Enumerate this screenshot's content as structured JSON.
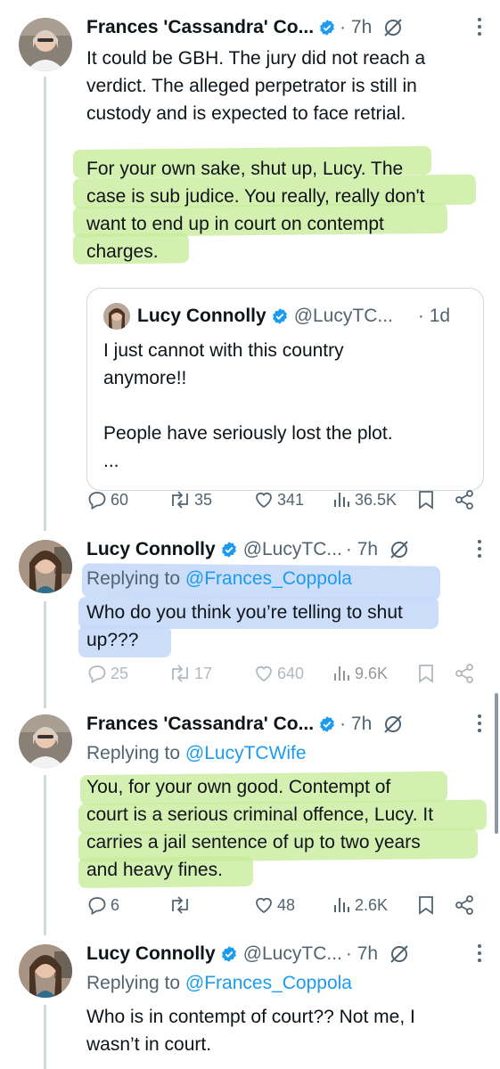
{
  "tweets": [
    {
      "author": "Frances 'Cassandra' Co...",
      "handle": "",
      "time": "· 7h",
      "text1": "It could be GBH. The jury did not reach a\nverdict. The alleged perpetrator is still in\ncustody and is expected to face retrial.",
      "text2": "For your own sake, shut up, Lucy. The\ncase is sub judice. You really, really don't\nwant to end up in court on contempt\ncharges.",
      "quote": {
        "author": "Lucy Connolly",
        "handle": "@LucyTC...",
        "time": "· 1d",
        "text": "I just cannot with this country\nanymore!!\n\nPeople have seriously lost the plot.\n..."
      },
      "replies": "60",
      "reposts": "35",
      "likes": "341",
      "views": "36.5K"
    },
    {
      "author": "Lucy Connolly",
      "handle": "@LucyTC...",
      "time": "· 7h",
      "replying_prefix": "Replying to",
      "replying_to": "@Frances_Coppola",
      "text": "Who do you think you’re telling to shut\nup???",
      "replies": "25",
      "reposts": "17",
      "likes": "640",
      "views": "9.6K"
    },
    {
      "author": "Frances 'Cassandra' Co...",
      "handle": "",
      "time": "· 7h",
      "replying_prefix": "Replying to",
      "replying_to": "@LucyTCWife",
      "text": "You, for your own good. Contempt of\ncourt is a serious criminal offence, Lucy. It\ncarries a jail sentence of up to two years\nand heavy fines.",
      "replies": "6",
      "reposts": "",
      "likes": "48",
      "views": "2.6K"
    },
    {
      "author": "Lucy Connolly",
      "handle": "@LucyTC...",
      "time": "· 7h",
      "replying_prefix": "Replying to",
      "replying_to": "@Frances_Coppola",
      "text": "Who is in contempt of court?? Not me, I\nwasn’t in court."
    }
  ],
  "colors": {
    "accent": "#1d9bf0",
    "muted": "#536471",
    "highlight_green": "#c8ec9c",
    "highlight_blue": "#c5d9f8"
  },
  "icons": [
    "verified-badge-icon",
    "grok-icon",
    "more-icon",
    "reply-icon",
    "repost-icon",
    "like-icon",
    "views-icon",
    "bookmark-icon",
    "share-icon"
  ]
}
